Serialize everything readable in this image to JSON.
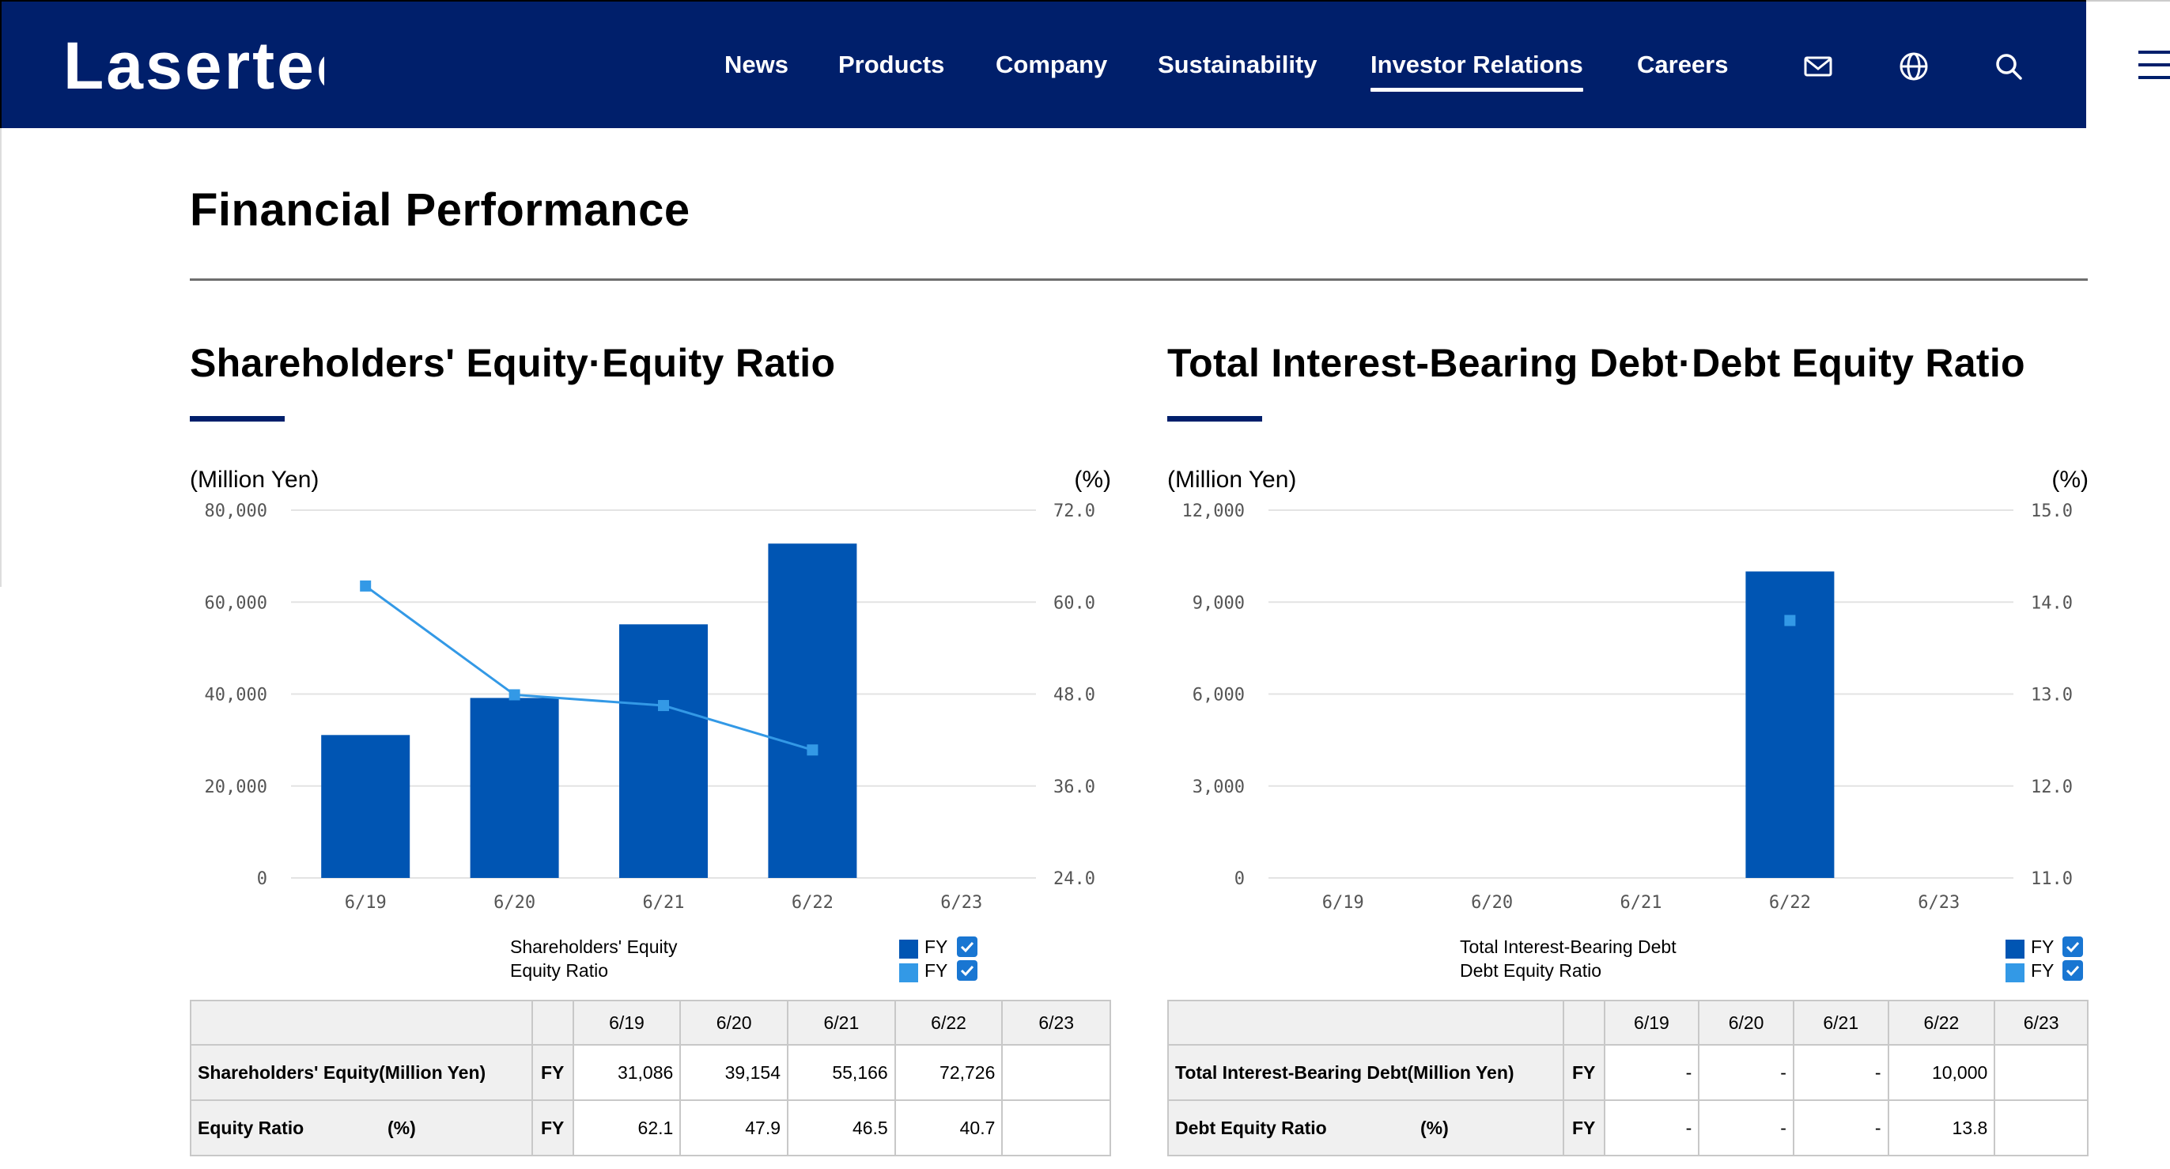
{
  "header": {
    "logo_text": "Lasertec",
    "nav": [
      "News",
      "Products",
      "Company",
      "Sustainability",
      "Investor Relations",
      "Careers"
    ],
    "active_nav": "Investor Relations",
    "icons": [
      "mail-icon",
      "globe-icon",
      "search-icon",
      "hamburger-menu-icon"
    ],
    "brand_color": "#001f6b"
  },
  "page": {
    "title": "Financial Performance"
  },
  "left": {
    "title": "Shareholders' Equity·Equity Ratio",
    "unit_left": "(Million Yen)",
    "unit_right": "(%)",
    "legend": [
      {
        "label": "Shareholders' Equity",
        "fy": "FY",
        "color": "#0055b3"
      },
      {
        "label": "Equity Ratio",
        "fy": "FY",
        "color": "#3399e6"
      }
    ],
    "table": {
      "headers": [
        "",
        "",
        "6/19",
        "6/20",
        "6/21",
        "6/22",
        "6/23"
      ],
      "rows": [
        {
          "label": "Shareholders' Equity(Million Yen)",
          "unit": "",
          "period": "FY",
          "values": [
            "31,086",
            "39,154",
            "55,166",
            "72,726",
            ""
          ]
        },
        {
          "label": "Equity Ratio",
          "unit": "(%)",
          "period": "FY",
          "values": [
            "62.1",
            "47.9",
            "46.5",
            "40.7",
            ""
          ]
        }
      ]
    }
  },
  "right": {
    "title": "Total Interest-Bearing Debt·Debt Equity Ratio",
    "unit_left": "(Million Yen)",
    "unit_right": "(%)",
    "legend": [
      {
        "label": "Total Interest-Bearing Debt",
        "fy": "FY",
        "color": "#0055b3"
      },
      {
        "label": "Debt Equity Ratio",
        "fy": "FY",
        "color": "#3399e6"
      }
    ],
    "table": {
      "headers": [
        "",
        "",
        "6/19",
        "6/20",
        "6/21",
        "6/22",
        "6/23"
      ],
      "rows": [
        {
          "label": "Total Interest-Bearing Debt(Million Yen)",
          "unit": "",
          "period": "FY",
          "values": [
            "-",
            "-",
            "-",
            "10,000",
            ""
          ]
        },
        {
          "label": "Debt Equity Ratio",
          "unit": "(%)",
          "period": "FY",
          "values": [
            "-",
            "-",
            "-",
            "13.8",
            ""
          ]
        }
      ]
    }
  },
  "chart_data": [
    {
      "type": "bar",
      "title": "Shareholders' Equity·Equity Ratio",
      "categories": [
        "6/19",
        "6/20",
        "6/21",
        "6/22",
        "6/23"
      ],
      "y_left": {
        "label": "(Million Yen)",
        "ylim": [
          0,
          80000
        ],
        "ticks": [
          "0",
          "20,000",
          "40,000",
          "60,000",
          "80,000"
        ],
        "tick_values": [
          0,
          20000,
          40000,
          60000,
          80000
        ]
      },
      "y_right": {
        "label": "(%)",
        "ylim": [
          24,
          72
        ],
        "ticks": [
          "24.0",
          "36.0",
          "48.0",
          "60.0",
          "72.0"
        ],
        "tick_values": [
          24,
          36,
          48,
          60,
          72
        ]
      },
      "series": [
        {
          "name": "Shareholders' Equity",
          "kind": "bar",
          "axis": "left",
          "color": "#0055b3",
          "values": [
            31086,
            39154,
            55166,
            72726,
            null
          ]
        },
        {
          "name": "Equity Ratio",
          "kind": "line",
          "axis": "right",
          "color": "#3399e6",
          "values": [
            62.1,
            47.9,
            46.5,
            40.7,
            null
          ]
        }
      ],
      "grid": true,
      "legend_position": "bottom"
    },
    {
      "type": "bar",
      "title": "Total Interest-Bearing Debt·Debt Equity Ratio",
      "categories": [
        "6/19",
        "6/20",
        "6/21",
        "6/22",
        "6/23"
      ],
      "y_left": {
        "label": "(Million Yen)",
        "ylim": [
          0,
          12000
        ],
        "ticks": [
          "0",
          "3,000",
          "6,000",
          "9,000",
          "12,000"
        ],
        "tick_values": [
          0,
          3000,
          6000,
          9000,
          12000
        ]
      },
      "y_right": {
        "label": "(%)",
        "ylim": [
          11,
          15
        ],
        "ticks": [
          "11.0",
          "12.0",
          "13.0",
          "14.0",
          "15.0"
        ],
        "tick_values": [
          11,
          12,
          13,
          14,
          15
        ]
      },
      "series": [
        {
          "name": "Total Interest-Bearing Debt",
          "kind": "bar",
          "axis": "left",
          "color": "#0055b3",
          "values": [
            null,
            null,
            null,
            10000,
            null
          ]
        },
        {
          "name": "Debt Equity Ratio",
          "kind": "line",
          "axis": "right",
          "color": "#3399e6",
          "values": [
            null,
            null,
            null,
            13.8,
            null
          ]
        }
      ],
      "grid": true,
      "legend_position": "bottom"
    }
  ]
}
